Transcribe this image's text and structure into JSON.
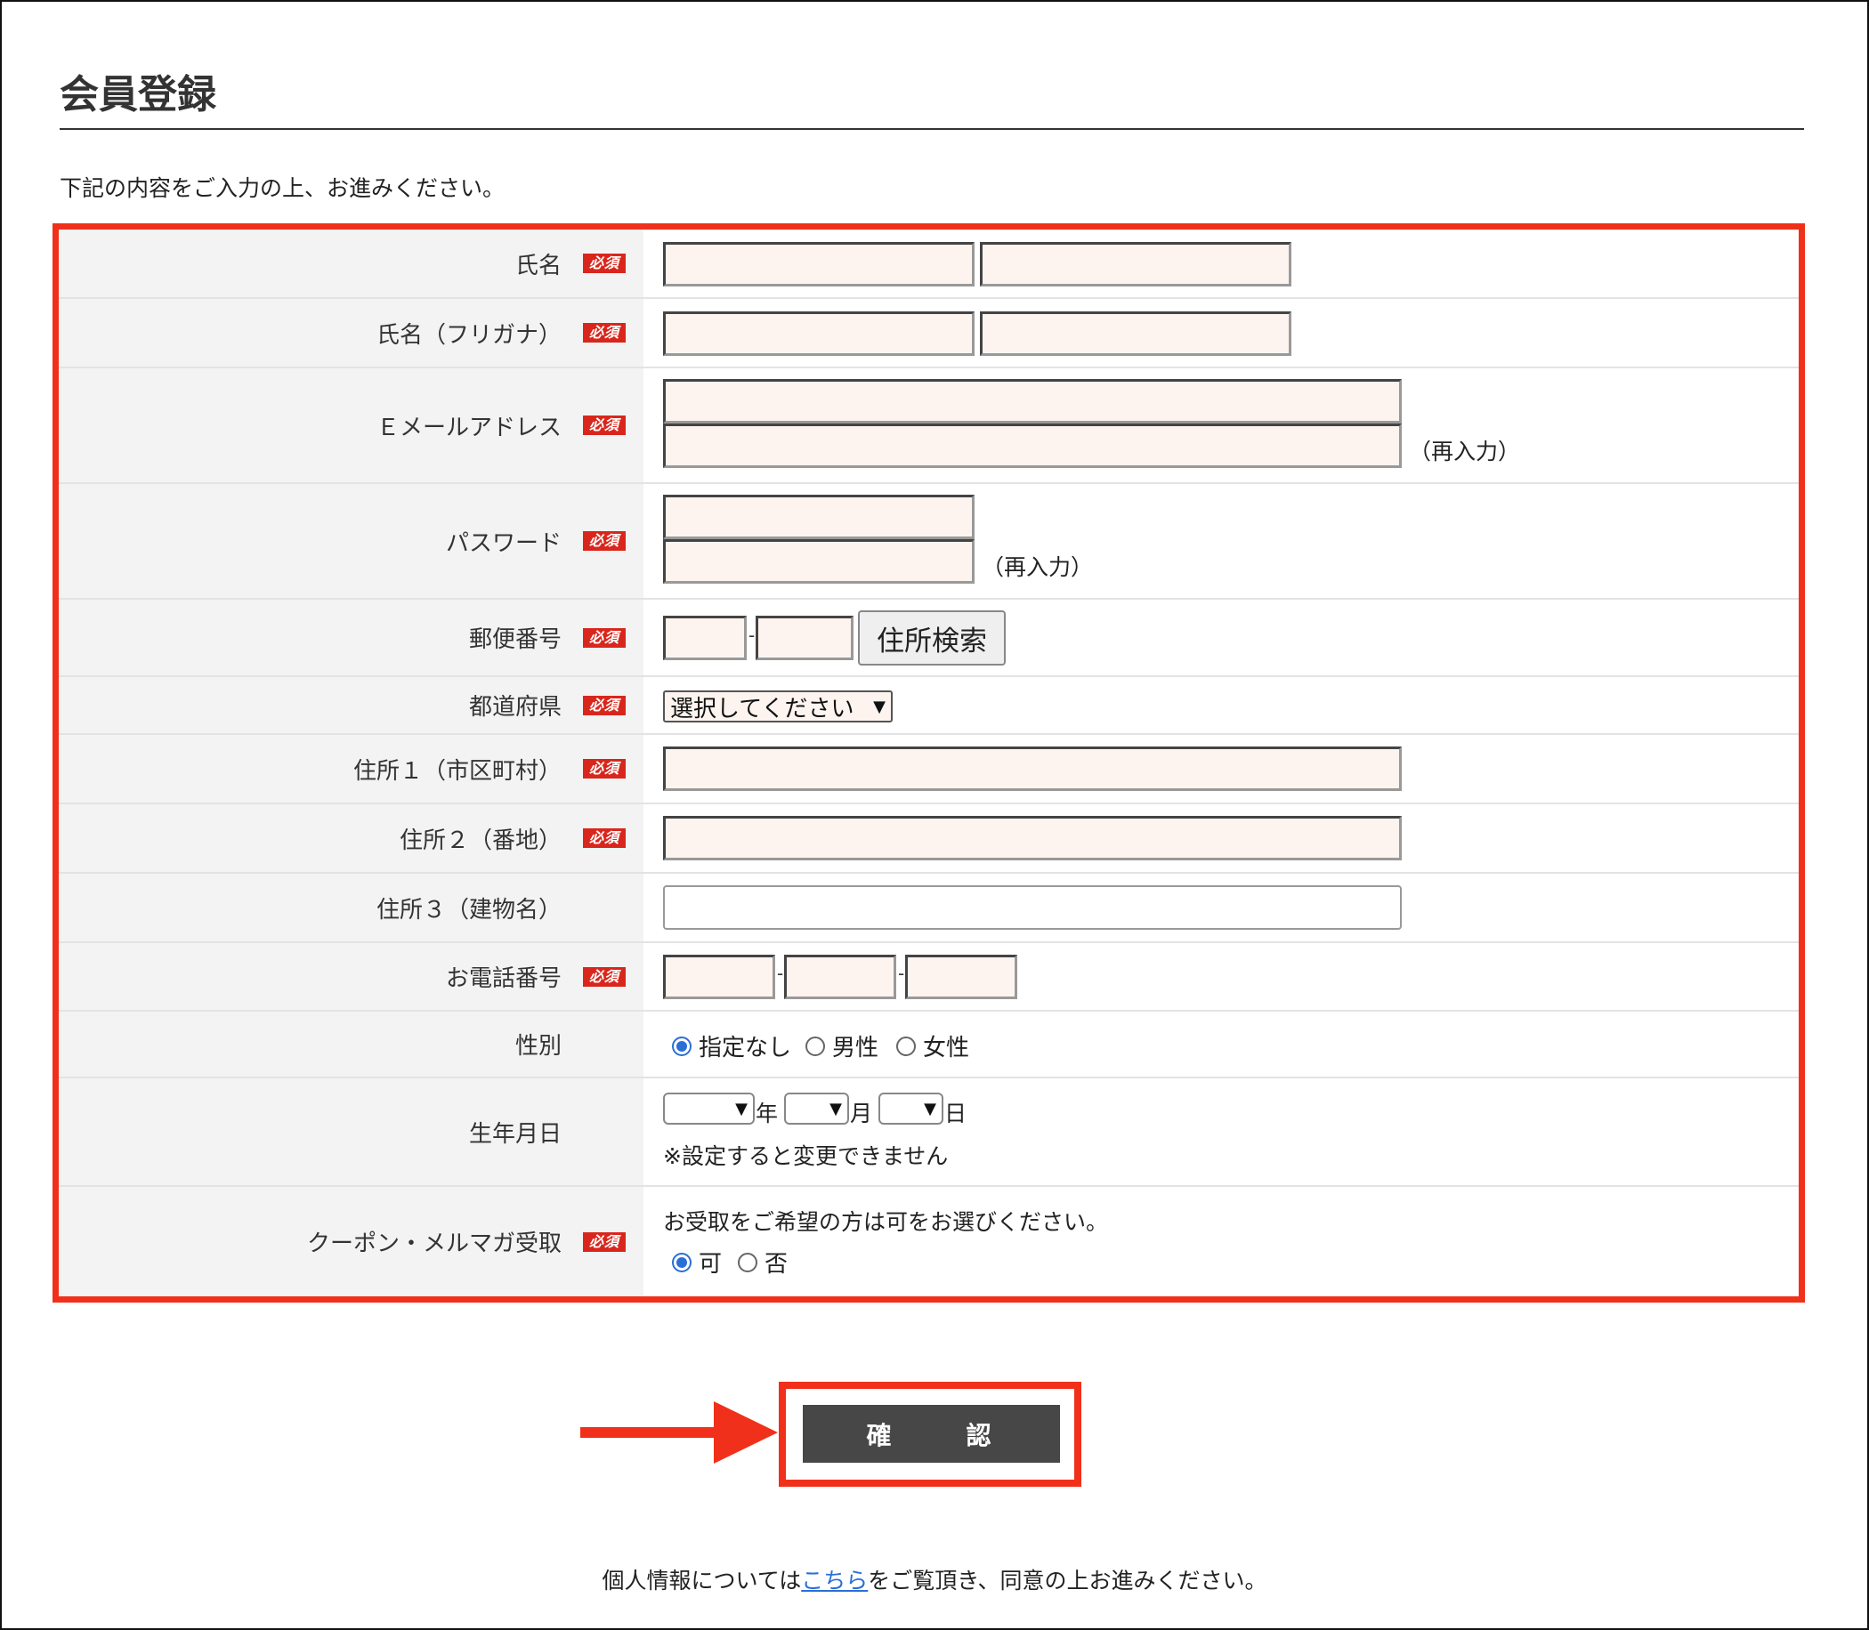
{
  "page": {
    "title": "会員登録",
    "lead": "下記の内容をご入力の上、お進みください。",
    "required_badge": "必須",
    "reenter_note": "（再入力）"
  },
  "fields": {
    "name": {
      "label": "氏名"
    },
    "kana": {
      "label": "氏名（フリガナ）"
    },
    "email": {
      "label": "Ｅメールアドレス"
    },
    "password": {
      "label": "パスワード"
    },
    "postal": {
      "label": "郵便番号",
      "hyphen": "-",
      "search_button": "住所検索"
    },
    "prefecture": {
      "label": "都道府県",
      "selected": "選択してください"
    },
    "address1": {
      "label": "住所１（市区町村）"
    },
    "address2": {
      "label": "住所２（番地）"
    },
    "address3": {
      "label": "住所３（建物名）"
    },
    "phone": {
      "label": "お電話番号",
      "hyphen": "-"
    },
    "gender": {
      "label": "性別",
      "options": [
        "指定なし",
        "男性",
        "女性"
      ],
      "selected": "指定なし"
    },
    "birthday": {
      "label": "生年月日",
      "year_unit": "年",
      "month_unit": "月",
      "day_unit": "日",
      "note": "※設定すると変更できません"
    },
    "newsletter": {
      "label": "クーポン・メルマガ受取",
      "prompt": "お受取をご希望の方は可をお選びください。",
      "options": [
        "可",
        "否"
      ],
      "selected": "可"
    }
  },
  "confirm_button": "確　認",
  "footer": {
    "before": "個人情報については",
    "link": "こちら",
    "after": "をご覧頂き、同意の上お進みください。"
  },
  "colors": {
    "highlight": "#f0301a",
    "required_badge": "#d9261c",
    "input_bg": "#fdf4f0",
    "button": "#474747",
    "link": "#2a6fd6"
  }
}
